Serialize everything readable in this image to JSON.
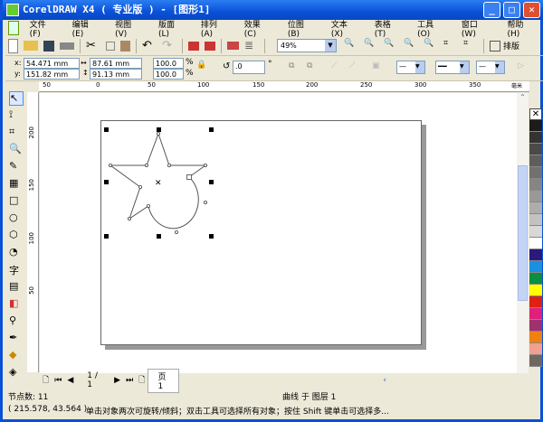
{
  "window": {
    "title": "CorelDRAW X4 ( 专业版 ) - [图形1]"
  },
  "menu": [
    "文件(F)",
    "编辑(E)",
    "视图(V)",
    "版面(L)",
    "排列(A)",
    "效果(C)",
    "位图(B)",
    "文本(X)",
    "表格(T)",
    "工具(O)",
    "窗口(W)",
    "帮助(H)"
  ],
  "toolbar": {
    "zoom_value": "49%",
    "layout_label": "排版"
  },
  "property_bar": {
    "x": "54.471 mm",
    "y": "151.82 mm",
    "width": "87.61 mm",
    "height": "91.13 mm",
    "scale_x": "100.0",
    "scale_y": "100.0",
    "pct": "%",
    "rotation": ".0",
    "degree": "°"
  },
  "ruler": {
    "h_ticks": [
      "50",
      "0",
      "50",
      "100",
      "150",
      "200",
      "250",
      "300",
      "350"
    ],
    "v_ticks": [
      "200",
      "150",
      "100",
      "50"
    ],
    "unit": "毫米"
  },
  "page_nav": {
    "counter": "1 / 1",
    "tab": "页 1"
  },
  "status": {
    "nodes": "节点数: 11",
    "object": "曲线 于 图层 1",
    "coords": "( 215.578, 43.564 )",
    "hint": "单击对象两次可旋转/倾斜；双击工具可选择所有对象；按住 Shift 键单击可选择多..."
  },
  "palette": [
    "#1c1c1c",
    "#333333",
    "#4a4a4a",
    "#5e5e5e",
    "#717171",
    "#858585",
    "#999999",
    "#adadad",
    "#c2c2c2",
    "#d8d8d8",
    "#ffffff",
    "#2a1a80",
    "#1a90e0",
    "#0a9040",
    "#ffff00",
    "#e02010",
    "#e0207a",
    "#a03070",
    "#f08010",
    "#f0a090",
    "#706860"
  ]
}
